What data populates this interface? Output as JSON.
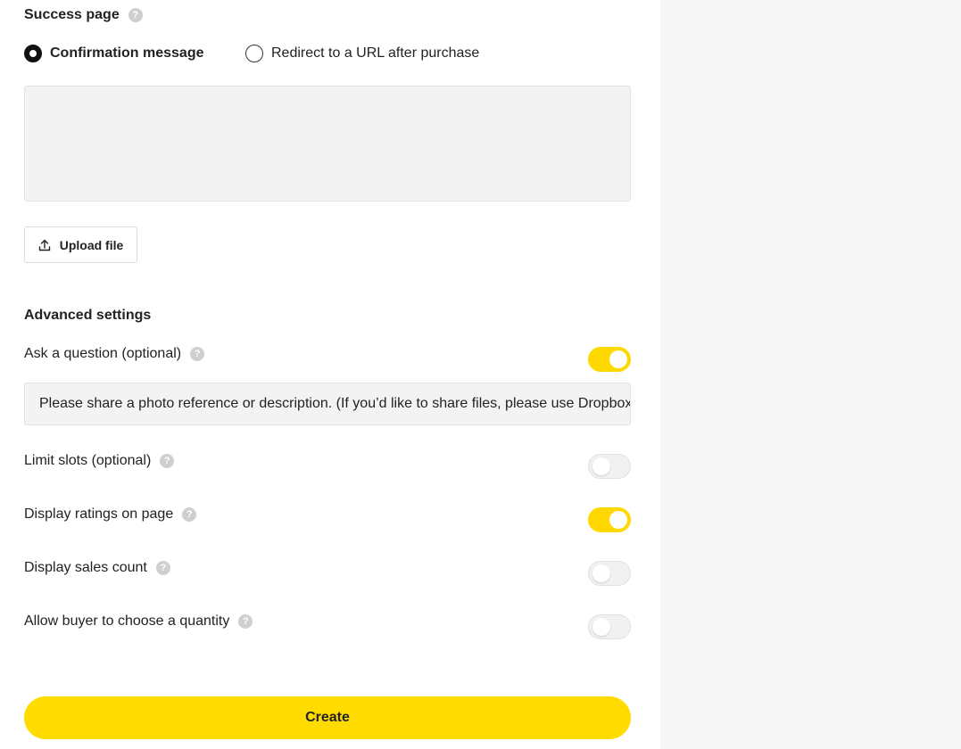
{
  "success_page": {
    "title": "Success page",
    "help_glyph": "?",
    "options": [
      {
        "label": "Confirmation message",
        "selected": true
      },
      {
        "label": "Redirect to a URL after purchase",
        "selected": false
      }
    ],
    "message_value": "",
    "upload_label": "Upload file",
    "upload_icon": "upload-icon"
  },
  "advanced": {
    "title": "Advanced settings",
    "ask_question": {
      "label": "Ask a question (optional)",
      "enabled": true
    },
    "question_value": "Please share a photo reference or description. (If you’d like to share files, please use Dropbox or Google Drive.)",
    "limit_slots": {
      "label": "Limit slots (optional)",
      "enabled": false
    },
    "display_ratings": {
      "label": "Display ratings on page",
      "enabled": true
    },
    "display_sales": {
      "label": "Display sales count",
      "enabled": false
    },
    "allow_quantity": {
      "label": "Allow buyer to choose a quantity",
      "enabled": false
    }
  },
  "create_label": "Create",
  "colors": {
    "accent": "#ffdb00",
    "toggle_on": "#ffd800",
    "toggle_off": "#f1f1f1",
    "side_panel": "#f7f7f7"
  }
}
